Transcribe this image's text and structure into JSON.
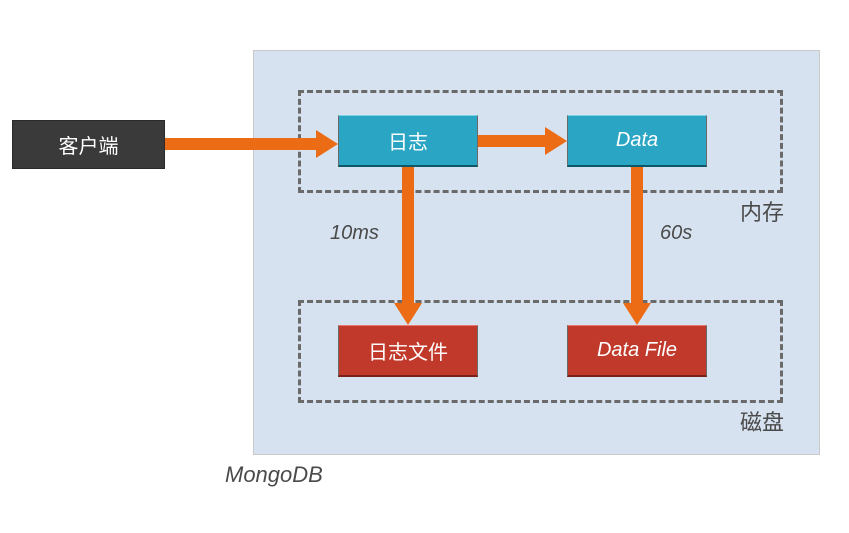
{
  "client": {
    "label": "客户端"
  },
  "database": {
    "label": "MongoDB"
  },
  "memory": {
    "group_label": "内存",
    "log_label": "日志",
    "data_label": "Data"
  },
  "disk": {
    "group_label": "磁盘",
    "log_file_label": "日志文件",
    "data_file_label": "Data File"
  },
  "flush": {
    "log_interval": "10ms",
    "data_interval": "60s"
  },
  "colors": {
    "arrow": "#ec6c16",
    "memory_node": "#2aa5c4",
    "disk_node": "#c0392b",
    "client_node": "#3a3a3a",
    "container_bg": "#d6e2ef"
  }
}
